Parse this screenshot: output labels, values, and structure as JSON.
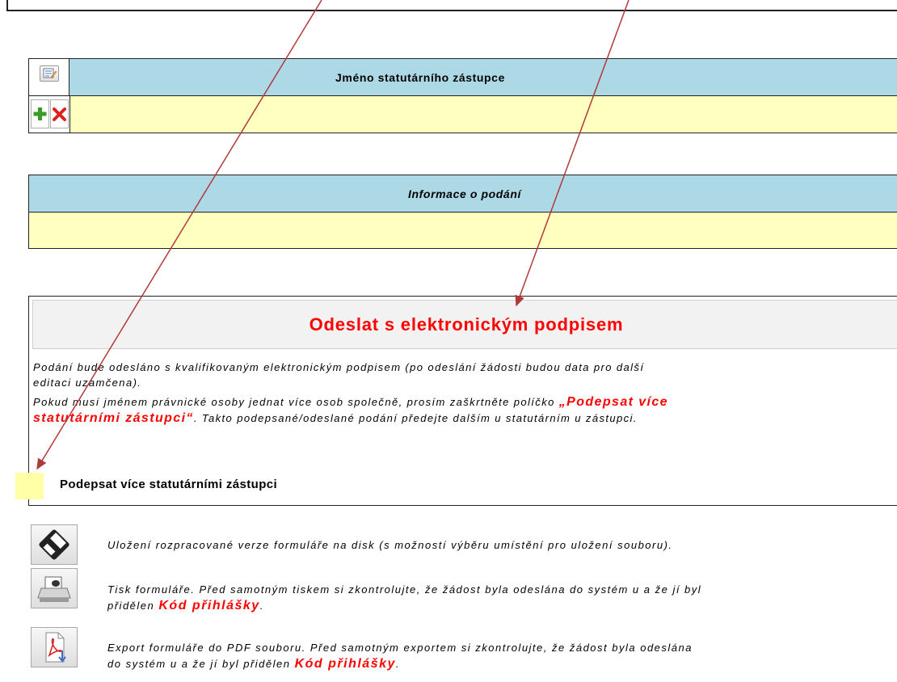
{
  "statutory_table": {
    "header": "Jméno statutárního zástupce"
  },
  "filing_info": {
    "header": "Informace o podání"
  },
  "signature_panel": {
    "title": "Odeslat s elektronickým podpisem",
    "paragraph1_line1": "Podání bude odesláno s kvalifikovaným elektronickým podpisem (po odeslání žádosti budou data pro další",
    "paragraph1_line2": "editaci uzamčena).",
    "paragraph2_line1_prefix": "Pokud musí jménem právnické osoby jednat více osob společně, prosím zaškrtněte políčko ",
    "paragraph2_highlight_line1": "„Podepsat více",
    "paragraph2_highlight_line2": "statutárními zástupci“",
    "paragraph2_line2_suffix": ". Takto podepsané/odeslané podání předejte dalším u statutárním u zástupci.",
    "checkbox_label": "Podepsat více statutárními zástupci"
  },
  "actions": {
    "save_text": "Uložení rozpracované verze formuláře na disk (s možností výběru umístění pro uložení souboru).",
    "print_line1": "Tisk formuláře. Před samotným tiskem si zkontrolujte, že žádost byla odeslána do systém u a že jí byl",
    "print_line2_prefix": "přidělen ",
    "print_code": "Kód přihlášky",
    "print_line2_suffix": ".",
    "export_line1": "Export formuláře do PDF souboru. Před samotným exportem si zkontrolujte, že žádost byla odeslána",
    "export_line2_prefix": "do systém u a že jí byl přidělen ",
    "export_code": "Kód přihlášky",
    "export_line2_suffix": "."
  },
  "colors": {
    "header_blue": "#add8e6",
    "input_yellow": "#ffffc0",
    "accent_red": "#ff0000",
    "annotation_arrow": "#b03a3a"
  }
}
